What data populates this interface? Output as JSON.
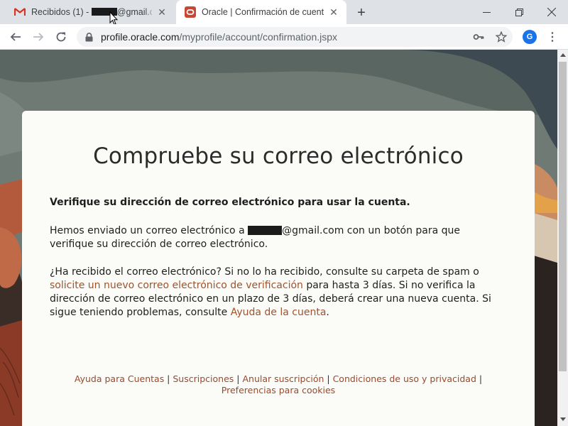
{
  "browser": {
    "tabs": [
      {
        "title_prefix": "Recibidos (1) - ",
        "title_suffix": "@gmail.com",
        "active": false,
        "favicon": "gmail-icon"
      },
      {
        "title": "Oracle | Confirmación de cuenta",
        "active": true,
        "favicon": "oracle-icon"
      }
    ],
    "address": {
      "host": "profile.oracle.com",
      "path": "/myprofile/account/confirmation.jspx"
    },
    "profile_initial": "G",
    "colors": {
      "tabstrip": "#dee1e6",
      "omnibox": "#f1f3f4",
      "avatar": "#1a73e8",
      "oracle_red": "#c74634",
      "gmail_red": "#d93025"
    }
  },
  "page": {
    "heading": "Compruebe su correo electrónico",
    "lead": "Verifique su dirección de correo electrónico para usar la cuenta.",
    "sent": {
      "before": "Hemos enviado un correo electrónico a ",
      "email_suffix": "@gmail.com",
      "after": " con un botón para que verifique su dirección de correo electrónico."
    },
    "received": {
      "before": "¿Ha recibido el correo electrónico? Si no lo ha recibido, consulte su carpeta de spam o ",
      "link_resend": "solicite un nuevo correo electrónico de verificación",
      "middle": " para hasta 3 días. Si no verifica la dirección de correo electrónico en un plazo de 3 días, deberá crear una nueva cuenta. Si sigue teniendo problemas, consulte ",
      "link_help": "Ayuda de la cuenta",
      "end": "."
    },
    "footer": {
      "links": [
        "Ayuda para Cuentas",
        "Suscripciones",
        "Anular suscripción",
        "Condiciones de uso y privacidad",
        "Preferencias para cookies"
      ],
      "separator": " | "
    },
    "colors": {
      "link": "#a0522d",
      "card": "#fbfbf8",
      "text": "#1e1e1e"
    }
  }
}
